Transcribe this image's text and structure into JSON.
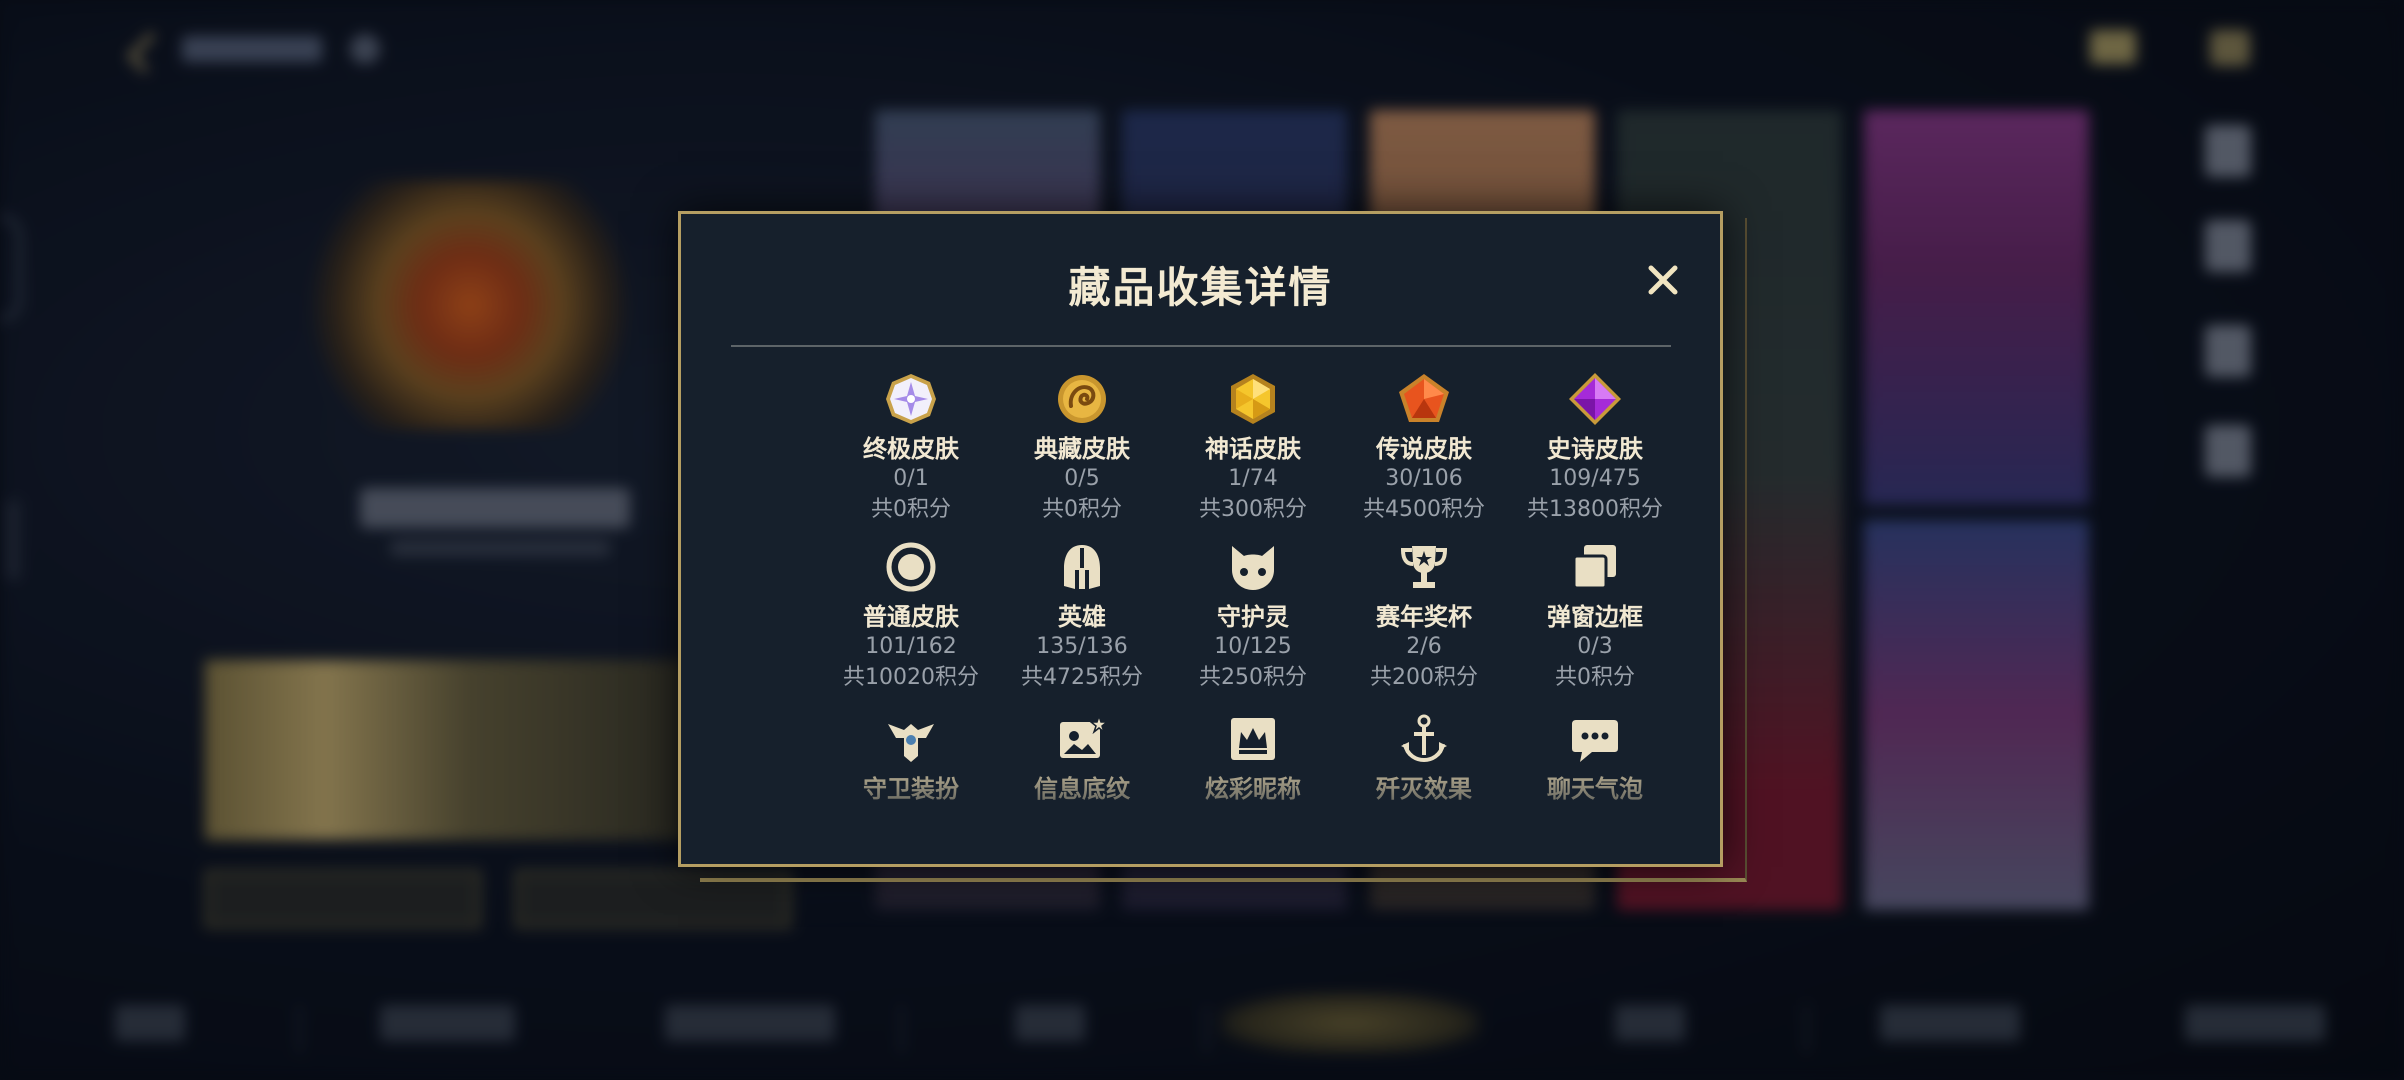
{
  "modal": {
    "title": "藏品收集详情",
    "close_icon": "close-icon"
  },
  "accent_colors": {
    "gold_border": "#b59e62",
    "modal_bg": "#16202c",
    "title_text": "#f3ead2",
    "secondary_text": "#9aa1aa"
  },
  "categories": [
    {
      "icon": "ultimate-skin-gem-icon",
      "name": "终极皮肤",
      "count": "0/1",
      "points": "共0积分"
    },
    {
      "icon": "collection-skin-dragon-icon",
      "name": "典藏皮肤",
      "count": "0/5",
      "points": "共0积分"
    },
    {
      "icon": "mythic-skin-gem-icon",
      "name": "神话皮肤",
      "count": "1/74",
      "points": "共300积分"
    },
    {
      "icon": "legendary-skin-gem-icon",
      "name": "传说皮肤",
      "count": "30/106",
      "points": "共4500积分"
    },
    {
      "icon": "epic-skin-gem-icon",
      "name": "史诗皮肤",
      "count": "109/475",
      "points": "共13800积分"
    },
    {
      "icon": "common-skin-ring-icon",
      "name": "普通皮肤",
      "count": "101/162",
      "points": "共10020积分"
    },
    {
      "icon": "hero-helmet-icon",
      "name": "英雄",
      "count": "135/136",
      "points": "共4725积分"
    },
    {
      "icon": "guardian-spirit-icon",
      "name": "守护灵",
      "count": "10/125",
      "points": "共250积分"
    },
    {
      "icon": "season-trophy-icon",
      "name": "赛年奖杯",
      "count": "2/6",
      "points": "共200积分"
    },
    {
      "icon": "popup-frame-icon",
      "name": "弹窗边框",
      "count": "0/3",
      "points": "共0积分"
    },
    {
      "icon": "guardian-outfit-icon",
      "name": "守卫装扮"
    },
    {
      "icon": "info-pattern-icon",
      "name": "信息底纹"
    },
    {
      "icon": "colorful-nickname-icon",
      "name": "炫彩昵称"
    },
    {
      "icon": "kill-effect-icon",
      "name": "歼灭效果"
    },
    {
      "icon": "chat-bubble-icon",
      "name": "聊天气泡"
    }
  ]
}
